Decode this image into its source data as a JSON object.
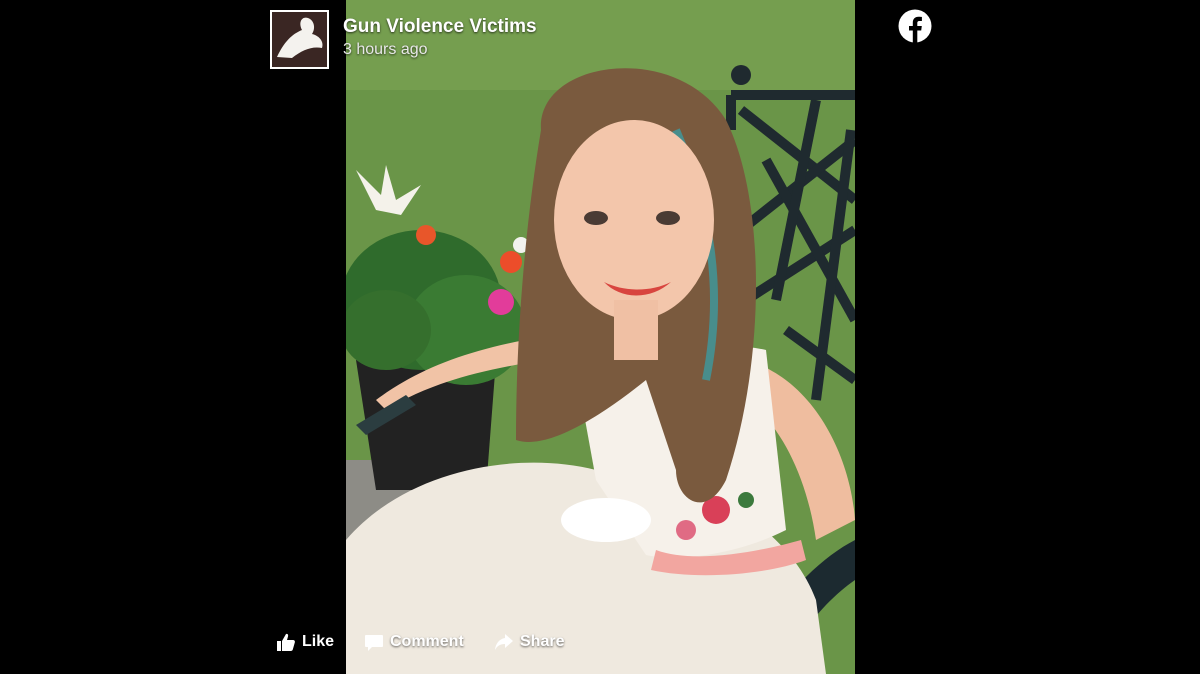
{
  "post": {
    "page_name": "Gun Violence Victims",
    "timestamp": "3 hours ago"
  },
  "actions": {
    "like_label": "Like",
    "comment_label": "Comment",
    "share_label": "Share"
  },
  "icons": {
    "brand": "facebook-icon",
    "like": "thumbs-up-icon",
    "comment": "comment-icon",
    "share": "share-arrow-icon"
  },
  "colors": {
    "background": "#000000",
    "text": "#ffffff",
    "brand_logo": "#ffffff"
  }
}
